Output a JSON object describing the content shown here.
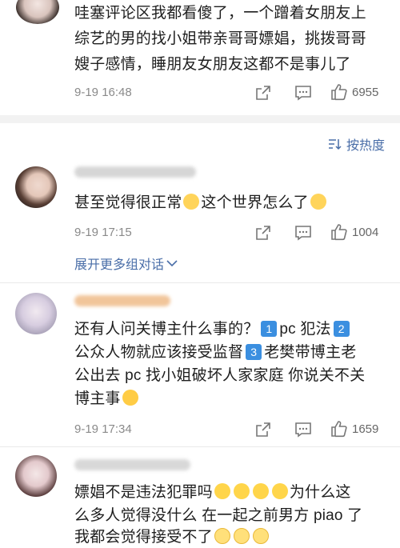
{
  "comment0": {
    "line1": "哇塞评论区我都看傻了，一个蹭着女朋友上",
    "line2": "综艺的男的找小姐带亲哥哥嫖娼，挑拨哥哥",
    "line3": "嫂子感情，睡朋友女朋友这都不是事儿了",
    "time": "9-19 16:48",
    "likes": "6955"
  },
  "sort_label": "按热度",
  "comment1": {
    "text_a": "甚至觉得很正常",
    "text_b": "这个世界怎么了",
    "time": "9-19 17:15",
    "likes": "1004",
    "expand": "展开更多组对话"
  },
  "comment2": {
    "line1": "还有人问关博主什么事的？",
    "n1": "1",
    "t1": "pc 犯法",
    "n2": "2",
    "line2": "公众人物就应该接受监督",
    "n3": "3",
    "t3": "老樊带博主老",
    "line3": "公出去 pc 找小姐破坏人家家庭 你说关不关",
    "line4": "博主事",
    "time": "9-19 17:34",
    "likes": "1659"
  },
  "comment3": {
    "line1a": "嫖娼不是违法犯罪吗",
    "line1b": "为什么这",
    "line2": "么多人觉得没什么 在一起之前男方 piao 了",
    "line3": "我都会觉得接受不了"
  },
  "colors": {
    "link": "#4a6ea8",
    "meta": "#8a8a8a",
    "divider": "#e9e9e9"
  }
}
